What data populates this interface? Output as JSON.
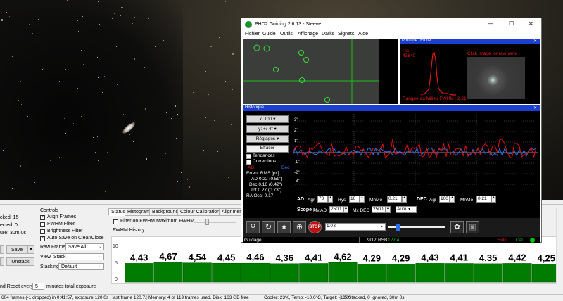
{
  "phd2": {
    "title": "PHD2 Guiding 2.6.13 - Steeve",
    "window_controls": [
      "—",
      "☐",
      "✕"
    ],
    "menu": [
      "Fichier",
      "Guide",
      "Outils",
      "Affichage",
      "Darks",
      "Signets",
      "Aide"
    ],
    "profile_panel": {
      "title": "Profil de l'Étoile",
      "label_pic": "Pic",
      "peak_value": "43840",
      "click_hint": "Click image for raw view",
      "fwhm_text": "Rangée du Milieu FWHM : 2.21"
    },
    "history_panel": {
      "title": "Historique",
      "x_scale": "x: 100",
      "y_scale": "y: +/-4\"",
      "settings_button": "Réglages",
      "clear_button": "Effacer",
      "trends_label": "Tendances",
      "corrections_label": "Corrections",
      "legend_ad": "AD",
      "legend_dec": "Dec",
      "rms_title": "Erreur RMS [px] :",
      "rms_ad": "AD 0.22 (0.59\")",
      "rms_dec": "Dec 0.16 (0.42\")",
      "rms_tot": "Tot 0.27 (0.73\")",
      "ra_osc": "RA Osc: 0.17",
      "y_ticks": [
        "3\"",
        "2\"",
        "1\"",
        "-1\"",
        "-2\"",
        "-3\""
      ]
    },
    "controls": {
      "ad_label": "AD :",
      "agr_label": "Agr",
      "ad_agr": "70",
      "hys_label": "Hys",
      "ad_hys": "10",
      "mnmo_label": "MnMo",
      "ad_mnmo": "0.21",
      "dec_label": "DEC :",
      "dec_agr": "100",
      "dec_mnmo": "0.21",
      "scope_label": "Scope :",
      "mx_ad_label": "Mx AD",
      "mx_ad": "2500",
      "mx_dec_label": "Mx DEC",
      "mx_dec": "2500",
      "mode": "Auto"
    },
    "toolbar": {
      "stop_label": "STOP",
      "exposure": "1.0 s"
    },
    "status": {
      "state": "Guidage",
      "frames": "9/12",
      "rsb_label": "RSB",
      "rsb": "127.4",
      "bulk": "Bulk",
      "cal": "Cal"
    }
  },
  "app": {
    "left_stats": {
      "stacked": "cked: 15",
      "rejected": "ected: 0",
      "exposure": "ure: 30m 0s"
    },
    "buttons": {
      "save": "Save",
      "unstack": "Unstack"
    },
    "controls": {
      "heading": "Controls",
      "align_frames": "Align Frames",
      "fwhm_filter": "FWHM Filter",
      "brightness_filter": "Brightness Filter",
      "auto_save": "Auto Save on Clear/Close",
      "raw_frames_label": "Raw Frames",
      "raw_frames_value": "Save All",
      "view_label": "View",
      "view_value": "Stack",
      "stacking_label": "Stacking",
      "stacking_value": "Default"
    },
    "reset": {
      "prefix": "nd Reset every",
      "value": "5",
      "suffix": "minutes total exposure"
    },
    "tabs": [
      "Status",
      "Histogram",
      "Background",
      "Colour Calibration",
      "Alignment"
    ],
    "filter_on_fwhm": "Filter on FWHM",
    "maximum_fwhm": "Maximum FWHM",
    "fwhm_history_title": "FWHM History",
    "status_bar": [
      "604 frames (-1 dropped) in 0:41:57, exposure 120.0s , last frame 120.7s",
      "Memory: 4 of 119 frames used. Disk: 163 GB free",
      "Cooler: 23%, Temp: -10.0°C, Target: -10.0°",
      "15 Stacked, 0 Ignored, 30m 0s"
    ]
  },
  "chart_data": {
    "type": "bar",
    "title": "FWHM History",
    "ylim": [
      0,
      10
    ],
    "y_ticks": [
      "10",
      "5",
      "0"
    ],
    "values": [
      4.43,
      4.67,
      4.54,
      4.45,
      4.46,
      4.36,
      4.41,
      4.62,
      4.29,
      4.29,
      4.43,
      4.41,
      4.35,
      4.42,
      4.25
    ],
    "labels": [
      "4,43",
      "4,67",
      "4,54",
      "4,45",
      "4,46",
      "4,36",
      "4,41",
      "4,62",
      "4,29",
      "4,29",
      "4,43",
      "4,41",
      "4,35",
      "4,42",
      "4,25"
    ],
    "bar_color": "#007d00",
    "grid": false
  },
  "colors": {
    "ra_line": "#e01010",
    "dec_line": "#2a6fe8",
    "bar": "#007d00",
    "rsb": "#20d020",
    "status_green": "#00c000"
  }
}
